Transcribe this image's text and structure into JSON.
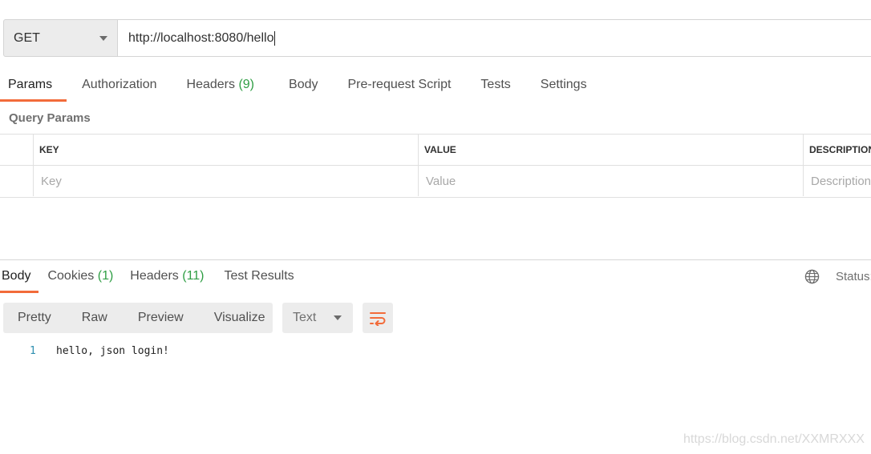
{
  "request": {
    "method": "GET",
    "url": "http://localhost:8080/hello"
  },
  "request_tabs": [
    {
      "label": "Params",
      "count": ""
    },
    {
      "label": "Authorization",
      "count": ""
    },
    {
      "label": "Headers",
      "count": "(9)"
    },
    {
      "label": "Body",
      "count": ""
    },
    {
      "label": "Pre-request Script",
      "count": ""
    },
    {
      "label": "Tests",
      "count": ""
    },
    {
      "label": "Settings",
      "count": ""
    }
  ],
  "query_params": {
    "title": "Query Params",
    "columns": [
      "KEY",
      "VALUE",
      "DESCRIPTION"
    ],
    "placeholders": [
      "Key",
      "Value",
      "Description"
    ]
  },
  "response_tabs": [
    {
      "label": "Body",
      "count": ""
    },
    {
      "label": "Cookies",
      "count": "(1)"
    },
    {
      "label": "Headers",
      "count": "(11)"
    },
    {
      "label": "Test Results",
      "count": ""
    }
  ],
  "status_label": "Status:",
  "format_buttons": [
    "Pretty",
    "Raw",
    "Preview",
    "Visualize"
  ],
  "language": "Text",
  "response_body": {
    "line_number": "1",
    "text": "hello, json login!"
  },
  "watermark": "https://blog.csdn.net/XXMRXXX",
  "colors": {
    "accent": "#f26b3a",
    "count": "#2f9e44"
  },
  "icons": {
    "globe": "globe-icon",
    "wrap": "wrap-lines-icon",
    "caret": "chevron-down-icon"
  }
}
